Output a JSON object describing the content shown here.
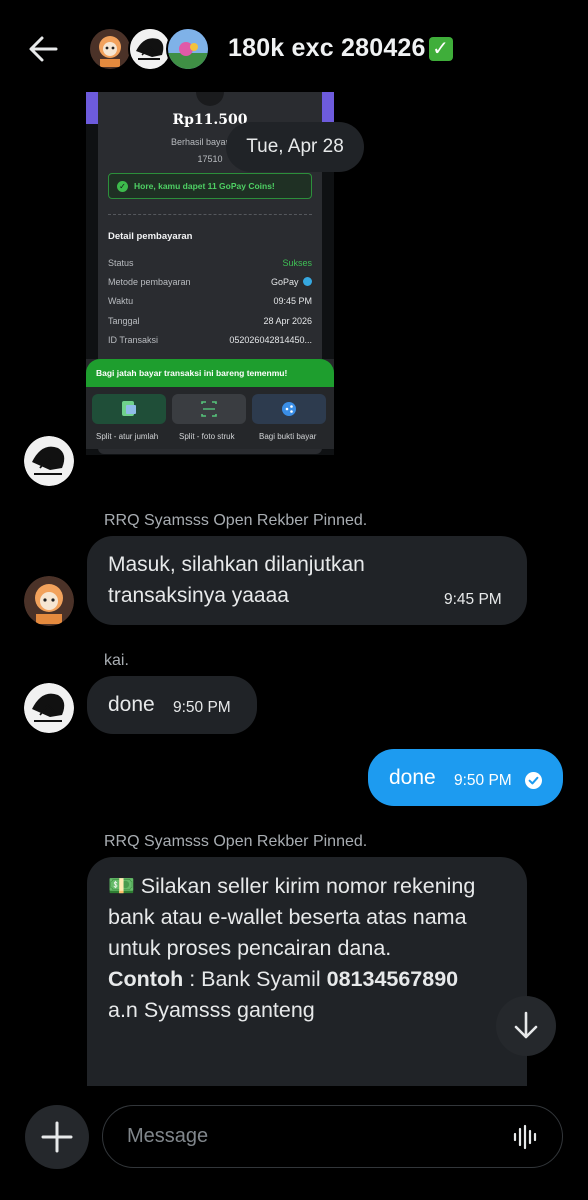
{
  "header": {
    "title": "180k exc 280426",
    "back_icon": "arrow-left-icon",
    "verified_icon": "check-box-icon"
  },
  "receipt": {
    "amount": "Rp11.500",
    "paid_to": "Berhasil bayar ke S",
    "ref": "17510",
    "coins": "Hore, kamu dapet 11 GoPay Coins!",
    "detail_title": "Detail pembayaran",
    "rows": [
      {
        "label": "Status",
        "value": "Sukses"
      },
      {
        "label": "Metode pembayaran",
        "value": "GoPay"
      },
      {
        "label": "Waktu",
        "value": "09:45 PM"
      },
      {
        "label": "Tanggal",
        "value": "28 Apr 2026"
      },
      {
        "label": "ID Transaksi",
        "value": "052026042814450..."
      }
    ],
    "share_banner": "Bagi jatah bayar transaksi ini bareng temenmu!",
    "actions": [
      "Split - atur jumlah",
      "Split - foto struk",
      "Bagi bukti bayar"
    ],
    "colors": {
      "accent_green": "#1e9e2e",
      "side_purple": "#6d5bdc"
    }
  },
  "date_divider": "Tue, Apr 28",
  "messages": [
    {
      "sender": "RRQ Syamsss Open Rekber Pinned.",
      "text": "Masuk, silahkan dilanjutkan transaksinya yaaaa",
      "time": "9:45 PM"
    },
    {
      "sender": "kai.",
      "text": "done",
      "time": "9:50 PM"
    },
    {
      "text": "done",
      "time": "9:50 PM",
      "outgoing": true
    },
    {
      "sender": "RRQ Syamsss Open Rekber Pinned.",
      "emoji": "💵",
      "line1": "Silakan seller kirim nomor rekening bank atau e-wallet beserta atas nama untuk proses pencairan dana.",
      "example_label": "Contoh",
      "example_sep": " : Bank Syamil ",
      "example_number": "08134567890",
      "example_name": "a.n Syamsss ganteng"
    }
  ],
  "composer": {
    "placeholder": "Message",
    "plus_icon": "plus-icon",
    "voice_icon": "voice-wave-icon",
    "scroll_icon": "arrow-down-icon"
  },
  "colors": {
    "background": "#000000",
    "bubble_in": "#202327",
    "bubble_out": "#1d9bf0"
  }
}
